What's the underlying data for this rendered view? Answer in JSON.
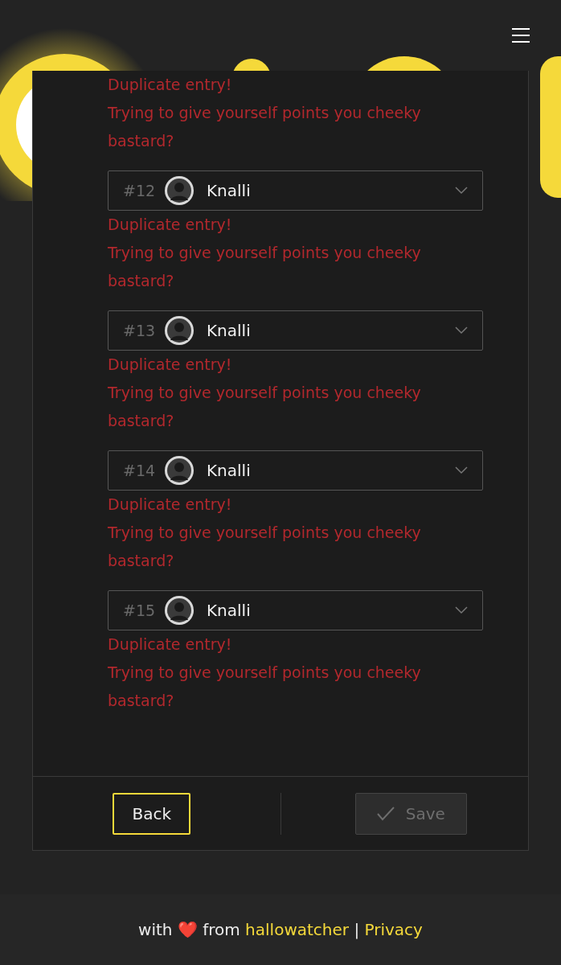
{
  "header": {
    "menu": true
  },
  "top_error": {
    "lines": [
      "Duplicate entry!",
      "Trying to give yourself points you cheeky bastard?"
    ]
  },
  "entries": [
    {
      "rank": "#12",
      "name": "Knalli",
      "errors": [
        "Duplicate entry!",
        "Trying to give yourself points you cheeky bastard?"
      ]
    },
    {
      "rank": "#13",
      "name": "Knalli",
      "errors": [
        "Duplicate entry!",
        "Trying to give yourself points you cheeky bastard?"
      ]
    },
    {
      "rank": "#14",
      "name": "Knalli",
      "errors": [
        "Duplicate entry!",
        "Trying to give yourself points you cheeky bastard?"
      ]
    },
    {
      "rank": "#15",
      "name": "Knalli",
      "errors": [
        "Duplicate entry!",
        "Trying to give yourself points you cheeky bastard?"
      ]
    }
  ],
  "actions": {
    "back": {
      "label": "Back"
    },
    "save": {
      "label": "Save",
      "disabled": true
    }
  },
  "footer": {
    "parts": [
      {
        "kind": "text",
        "text": "with"
      },
      {
        "kind": "heart",
        "text": "❤️"
      },
      {
        "kind": "text",
        "text": "from"
      },
      {
        "kind": "link",
        "text": "hallowatcher"
      },
      {
        "kind": "text",
        "text": "|"
      },
      {
        "kind": "link",
        "text": "Privacy"
      }
    ]
  }
}
